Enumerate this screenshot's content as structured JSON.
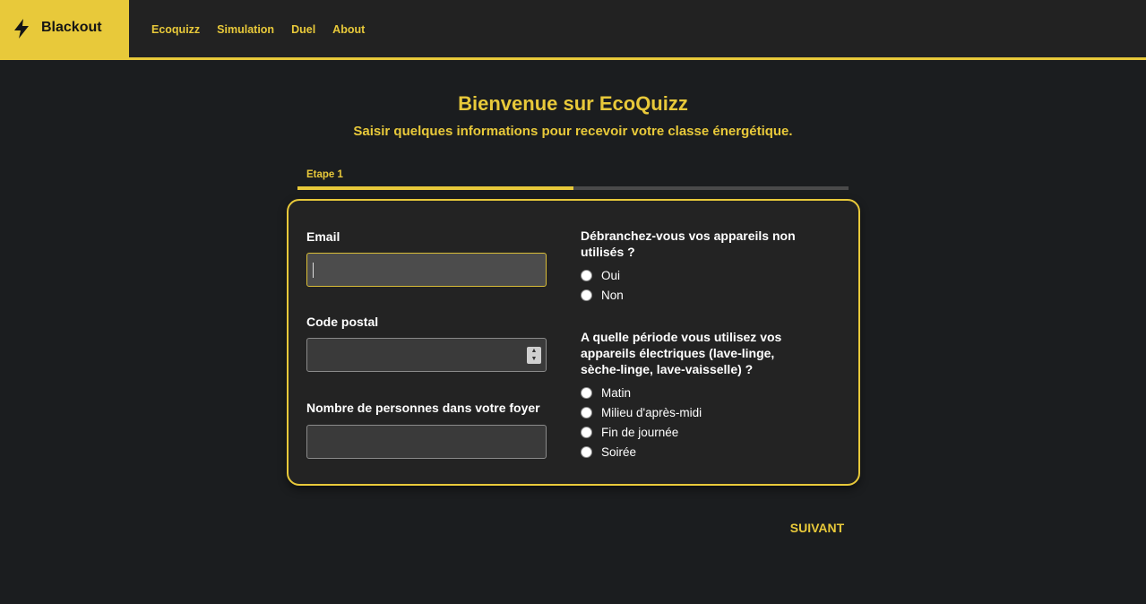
{
  "brand": {
    "name": "Blackout",
    "icon": "lightning-bolt-icon"
  },
  "nav": {
    "items": [
      "Ecoquizz",
      "Simulation",
      "Duel",
      "About"
    ]
  },
  "header": {
    "title": "Bienvenue sur EcoQuizz",
    "subtitle": "Saisir quelques informations pour recevoir votre classe énergétique."
  },
  "stepper": {
    "label": "Etape 1",
    "progress": 0.5
  },
  "form": {
    "email": {
      "label": "Email",
      "value": ""
    },
    "postal_code": {
      "label": "Code postal",
      "value": ""
    },
    "household": {
      "label": "Nombre de personnes dans votre foyer",
      "value": ""
    },
    "unplug": {
      "question_line1": "Débranchez-vous vos appareils non",
      "question_line2": "utilisés ?",
      "options": [
        "Oui",
        "Non"
      ]
    },
    "period": {
      "question_line1": "A quelle période vous utilisez vos",
      "question_line2": "appareils électriques (lave-linge,",
      "question_line3": "sèche-linge, lave-vaisselle) ?",
      "options": [
        "Matin",
        "Milieu d'après-midi",
        "Fin de journée",
        "Soirée"
      ]
    }
  },
  "actions": {
    "next_label": "SUIVANT"
  },
  "colors": {
    "accent": "#e8c93a",
    "background": "#1b1d1f",
    "card": "#232323"
  }
}
